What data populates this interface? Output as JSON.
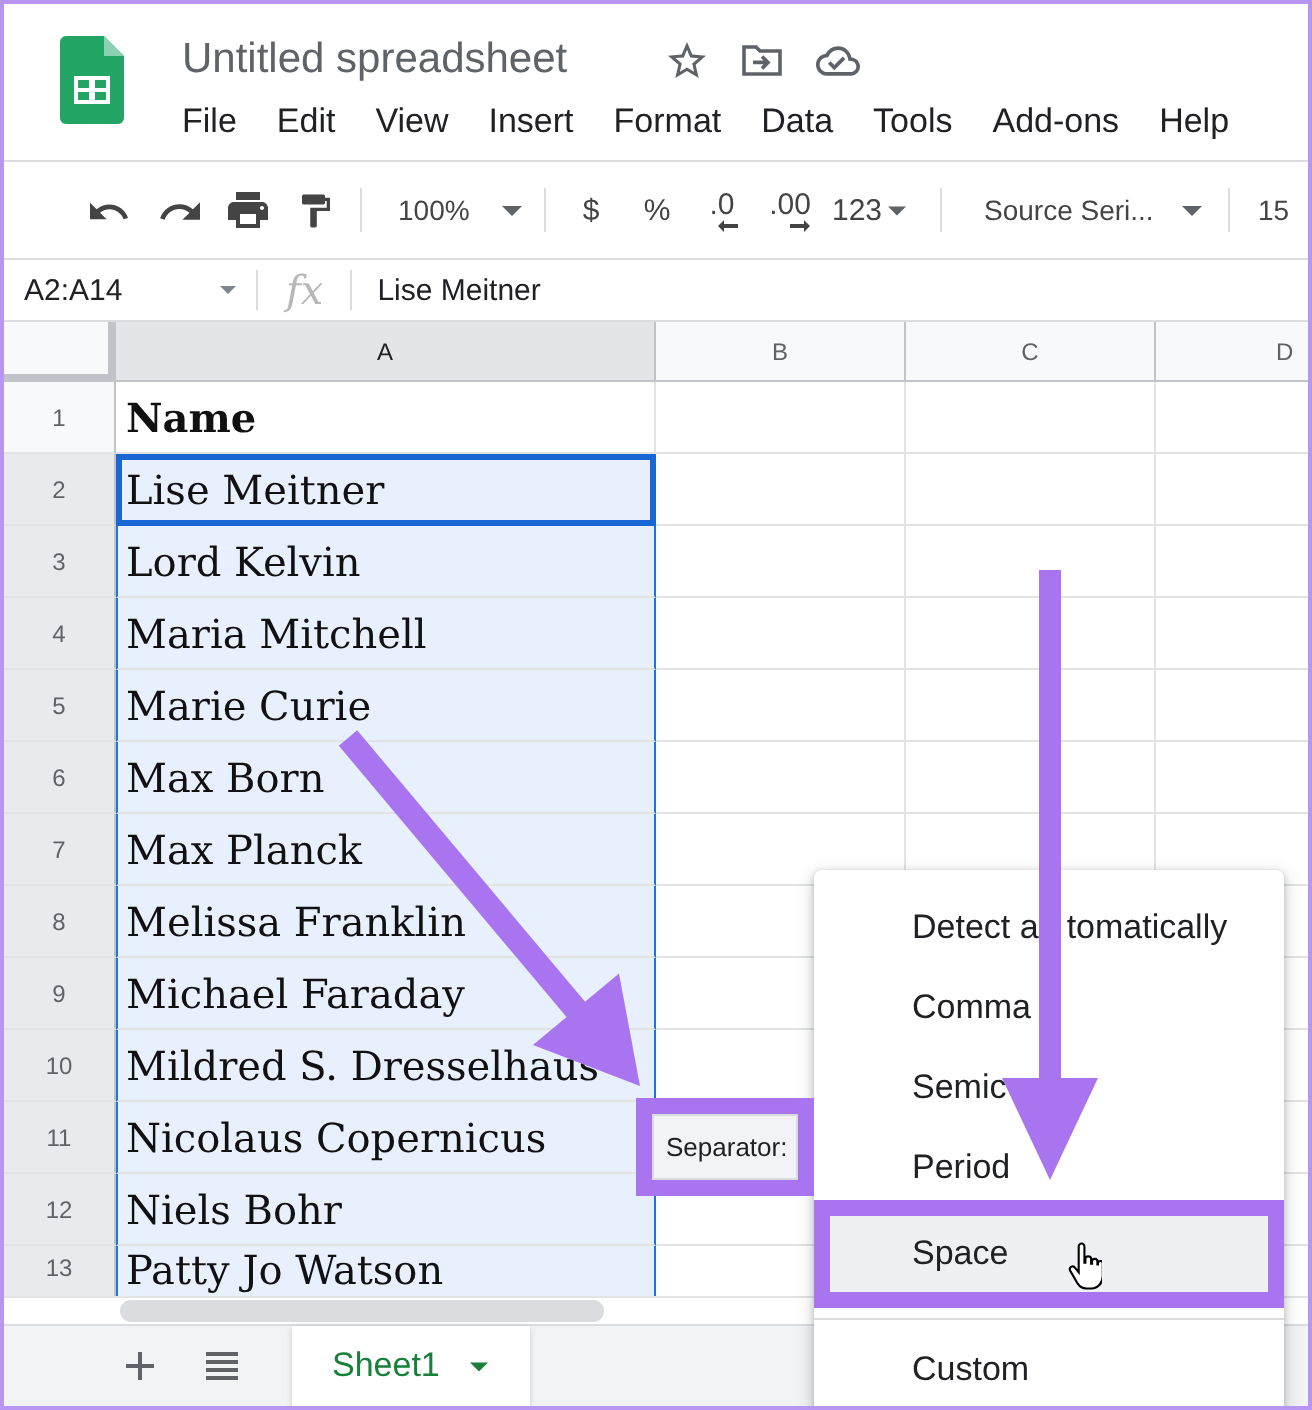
{
  "document": {
    "title": "Untitled spreadsheet",
    "menu": [
      "File",
      "Edit",
      "View",
      "Insert",
      "Format",
      "Data",
      "Tools",
      "Add-ons",
      "Help"
    ]
  },
  "toolbar": {
    "zoom": "100%",
    "format_buttons": [
      {
        "label": "$",
        "kind": "plain"
      },
      {
        "label": "%",
        "kind": "plain"
      },
      {
        "label": ".0",
        "kind": "decrease"
      },
      {
        "label": ".00",
        "kind": "increase"
      },
      {
        "label": "123",
        "kind": "dropdown"
      }
    ],
    "font": "Source Seri...",
    "font_size": "15"
  },
  "formula_bar": {
    "name_box": "A2:A14",
    "function_label": "fx",
    "value": "Lise Meitner"
  },
  "columns": [
    {
      "label": "A",
      "selected": true
    },
    {
      "label": "B",
      "selected": false
    },
    {
      "label": "C",
      "selected": false
    },
    {
      "label": "D",
      "selected": false
    }
  ],
  "rows": [
    {
      "number": "1",
      "value": "Name",
      "kind": "header",
      "selected": false,
      "active": false
    },
    {
      "number": "2",
      "value": "Lise Meitner",
      "kind": "data",
      "selected": true,
      "active": true
    },
    {
      "number": "3",
      "value": "Lord Kelvin",
      "kind": "data",
      "selected": true,
      "active": false
    },
    {
      "number": "4",
      "value": "Maria Mitchell",
      "kind": "data",
      "selected": true,
      "active": false
    },
    {
      "number": "5",
      "value": "Marie Curie",
      "kind": "data",
      "selected": true,
      "active": false
    },
    {
      "number": "6",
      "value": "Max Born",
      "kind": "data",
      "selected": true,
      "active": false
    },
    {
      "number": "7",
      "value": "Max Planck",
      "kind": "data",
      "selected": true,
      "active": false
    },
    {
      "number": "8",
      "value": "Melissa Franklin",
      "kind": "data",
      "selected": true,
      "active": false
    },
    {
      "number": "9",
      "value": "Michael Faraday",
      "kind": "data",
      "selected": true,
      "active": false
    },
    {
      "number": "10",
      "value": "Mildred S. Dresselhaus",
      "kind": "data",
      "selected": true,
      "active": false
    },
    {
      "number": "11",
      "value": "Nicolaus Copernicus",
      "kind": "data",
      "selected": true,
      "active": false
    },
    {
      "number": "12",
      "value": "Niels Bohr",
      "kind": "data",
      "selected": true,
      "active": false
    },
    {
      "number": "13",
      "value": "Patty Jo Watson",
      "kind": "data",
      "selected": true,
      "active": false
    }
  ],
  "separator_chip": {
    "label": "Separator:",
    "highlighted": true
  },
  "separator_menu": {
    "groups": [
      {
        "items": [
          {
            "label": "Detect a",
            "label_continued": "tomatically",
            "hovered": false,
            "highlighted": false
          },
          {
            "label": "Comma",
            "hovered": false,
            "highlighted": false
          },
          {
            "label": "Semic",
            "hovered": false,
            "highlighted": false
          },
          {
            "label": "Period",
            "hovered": false,
            "highlighted": false
          },
          {
            "label": "Space",
            "hovered": true,
            "highlighted": true
          }
        ]
      },
      {
        "items": [
          {
            "label": "Custom",
            "hovered": false,
            "highlighted": false
          }
        ]
      }
    ]
  },
  "sheet_tabs": [
    {
      "label": "Sheet1",
      "selected": true
    }
  ]
}
